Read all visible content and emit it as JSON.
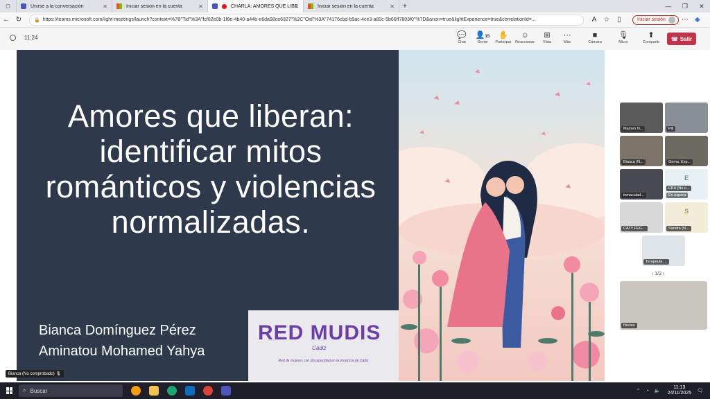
{
  "browser": {
    "tabs": [
      {
        "label": "Unirse a la conversación",
        "active": false,
        "favicon_color": "#4b53bc"
      },
      {
        "label": "Iniciar sesión en la cuenta",
        "active": false,
        "favicon_color": "#f25022"
      },
      {
        "label": "CHARLA: AMORES QUE LIBE",
        "active": true,
        "favicon_color": "#4b53bc"
      },
      {
        "label": "Iniciar sesión en la cuenta",
        "active": false,
        "favicon_color": "#f25022"
      }
    ],
    "url": "https://teams.microsoft.com/light-meetings/launch?context=%7B\"Tid\"%3A\"fcf82e0b-1f8e-4b40-a44b-e6da98ce6327\"%2C\"Oid\"%3A\"74176cbd-b9ac-4ce3-a80c-5b66ff7803f0\"%7D&anon=true&lightExperience=true&correlationId=...",
    "signin_label": "Iniciar sesión"
  },
  "meeting": {
    "elapsed": "11:24",
    "toolbar": {
      "chat": "Chat",
      "people": "Gente",
      "people_count": "15",
      "raise": "Participar",
      "react": "Reaccionar",
      "view": "Vista",
      "more": "Más",
      "camera": "Cámara",
      "mic": "Micro",
      "share": "Compartir",
      "leave": "Salir"
    }
  },
  "slide": {
    "title": "Amores que liberan: identificar mitos románticos y violencias normalizadas.",
    "author1": "Bianca Domínguez Pérez",
    "author2": "Aminatou Mohamed Yahya",
    "logo_main": "RED MUDIS",
    "logo_sub": "Cádiz",
    "logo_tagline": "Red de mujeres con discapacidad en la provincia de Cádiz"
  },
  "speaker_label": "Bianca (No comprobado)",
  "participants": [
    {
      "name": "Mamen N...",
      "bg": "#5b5b5b"
    },
    {
      "name": "Pili",
      "bg": "#8a8f95"
    },
    {
      "name": "Bianca (N...",
      "bg": "#7c7468"
    },
    {
      "name": "Gema. Esp...",
      "bg": "#6d6a62"
    },
    {
      "name": "inmaculad...",
      "bg": "#4a4a52"
    },
    {
      "name": "ERA (No c...",
      "bg": "#e7f0f2",
      "letter": "E",
      "status": "En espera"
    },
    {
      "name": "CATY FEG...",
      "bg": "#d8d8d8"
    },
    {
      "name": "Sandra (N...",
      "bg": "#f3ecd9",
      "letter": "S"
    },
    {
      "name": "Terapeuta ...",
      "bg": "#dfe4e8"
    }
  ],
  "pager": "1/2",
  "self_tile_name": "Nieves",
  "taskbar": {
    "search_placeholder": "Buscar",
    "time": "11:13",
    "date": "24/11/2025"
  }
}
